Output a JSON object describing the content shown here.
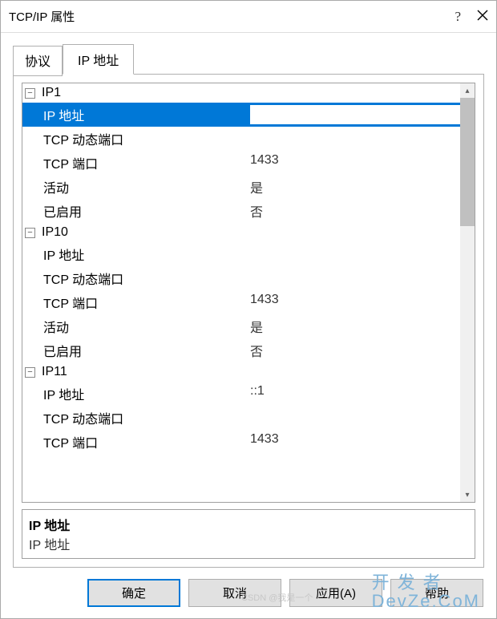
{
  "titlebar": {
    "title": "TCP/IP 属性"
  },
  "tabs": {
    "protocol": "协议",
    "ipaddress": "IP 地址"
  },
  "grid": {
    "groups": [
      {
        "name": "IP1",
        "items": [
          {
            "label": "IP 地址",
            "value": "",
            "selected": true
          },
          {
            "label": "TCP 动态端口",
            "value": ""
          },
          {
            "label": "TCP 端口",
            "value": "1433"
          },
          {
            "label": "活动",
            "value": "是"
          },
          {
            "label": "已启用",
            "value": "否"
          }
        ]
      },
      {
        "name": "IP10",
        "items": [
          {
            "label": "IP 地址",
            "value": ""
          },
          {
            "label": "TCP 动态端口",
            "value": ""
          },
          {
            "label": "TCP 端口",
            "value": "1433"
          },
          {
            "label": "活动",
            "value": "是"
          },
          {
            "label": "已启用",
            "value": "否"
          }
        ]
      },
      {
        "name": "IP11",
        "items": [
          {
            "label": "IP 地址",
            "value": "::1"
          },
          {
            "label": "TCP 动态端口",
            "value": ""
          },
          {
            "label": "TCP 端口",
            "value": "1433"
          }
        ]
      }
    ]
  },
  "description": {
    "title": "IP 地址",
    "text": "IP 地址"
  },
  "buttons": {
    "ok": "确定",
    "cancel": "取消",
    "apply": "应用(A)",
    "help": "帮助"
  },
  "watermark": {
    "cn": "开发者",
    "en": "DevZe.CoM",
    "csdn": "CSDN @我是一个"
  }
}
